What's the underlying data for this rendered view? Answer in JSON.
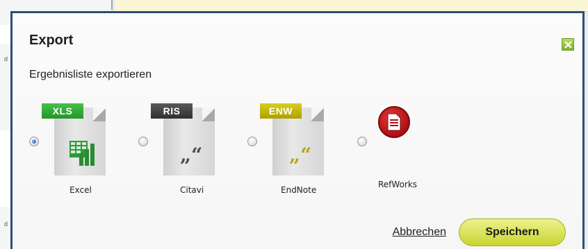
{
  "background": {
    "tiny_text_1": "d",
    "tiny_text_2": "d"
  },
  "dialog": {
    "title": "Export",
    "subtitle": "Ergebnisliste exportieren",
    "close_icon": "close-x-icon",
    "options": [
      {
        "tag": "XLS",
        "label": "Excel",
        "checked": true,
        "icon": "excel-spreadsheet-icon"
      },
      {
        "tag": "RIS",
        "label": "Citavi",
        "checked": false,
        "icon": "quote-document-icon"
      },
      {
        "tag": "ENW",
        "label": "EndNote",
        "checked": false,
        "icon": "quote-document-icon"
      },
      {
        "tag": "",
        "label": "RefWorks",
        "checked": false,
        "icon": "refworks-document-icon"
      }
    ],
    "buttons": {
      "cancel": "Abbrechen",
      "save": "Speichern"
    },
    "colors": {
      "border": "#2e4e72",
      "xls_tag": "#239628",
      "ris_tag": "#2f2f2f",
      "enw_tag": "#aea000",
      "refworks": "#b10f14",
      "save_button": "#c8d52f"
    }
  }
}
